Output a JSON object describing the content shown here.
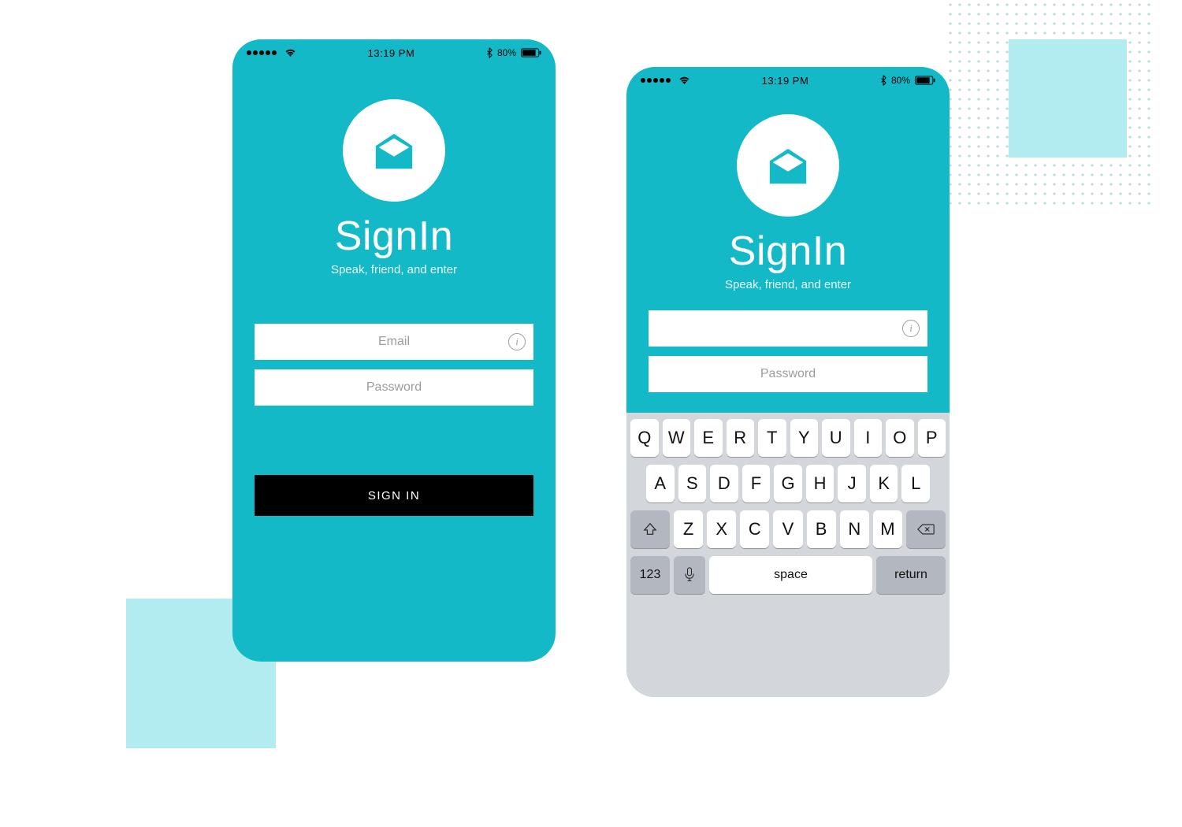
{
  "status": {
    "time": "13:19 PM",
    "battery_pct": "80%"
  },
  "app": {
    "title": "SignIn",
    "subtitle": "Speak, friend, and enter"
  },
  "form": {
    "email_placeholder": "Email",
    "password_placeholder": "Password",
    "info_glyph": "i"
  },
  "actions": {
    "signin_label": "SIGN IN"
  },
  "keyboard": {
    "row1": [
      "Q",
      "W",
      "E",
      "R",
      "T",
      "Y",
      "U",
      "I",
      "O",
      "P"
    ],
    "row2": [
      "A",
      "S",
      "D",
      "F",
      "G",
      "H",
      "J",
      "K",
      "L"
    ],
    "row3": [
      "Z",
      "X",
      "C",
      "V",
      "B",
      "N",
      "M"
    ],
    "numbers_label": "123",
    "space_label": "space",
    "return_label": "return"
  },
  "colors": {
    "brand": "#14b9c7",
    "accent_light": "#b2ecf1"
  }
}
